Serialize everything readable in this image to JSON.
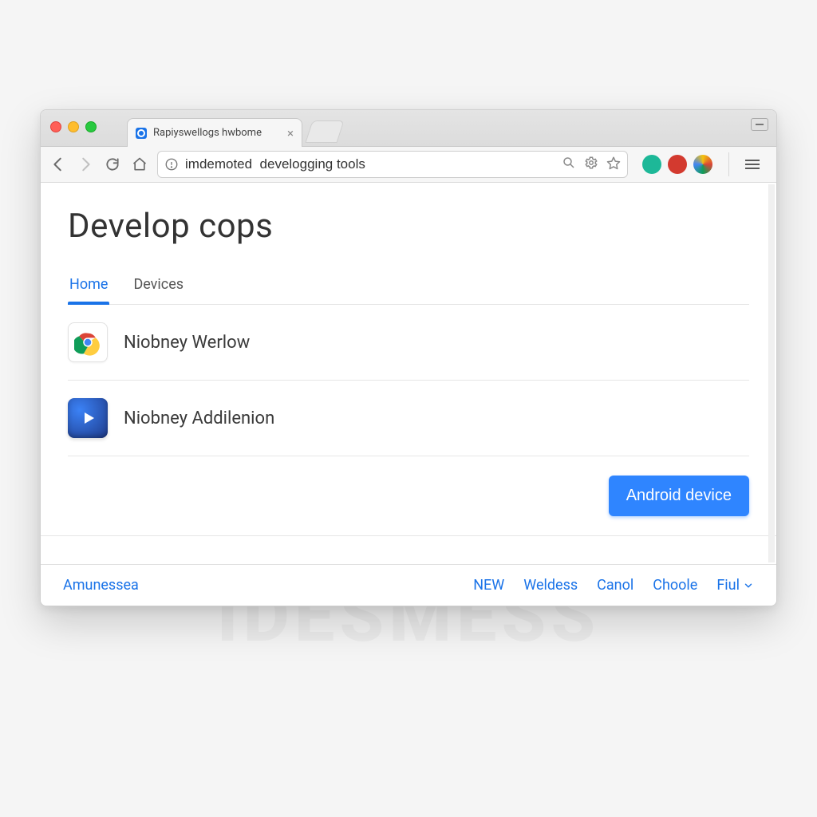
{
  "browser": {
    "tab_title": "Rapiyswellogs hwbome",
    "omnibox_value": "imdemoted  develogging tools"
  },
  "page": {
    "title": "Develop cops",
    "tabs": [
      {
        "label": "Home",
        "active": true
      },
      {
        "label": "Devices",
        "active": false
      }
    ],
    "items": [
      {
        "label": "Niobney Werlow",
        "icon": "chrome"
      },
      {
        "label": "Niobney Addilenion",
        "icon": "play"
      }
    ],
    "cta_label": "Android device"
  },
  "footer": {
    "left": "Amunessea",
    "links": [
      "NEW",
      "Weldess",
      "Canol",
      "Choole",
      "Fiul"
    ]
  },
  "watermark": "IDESMESS"
}
